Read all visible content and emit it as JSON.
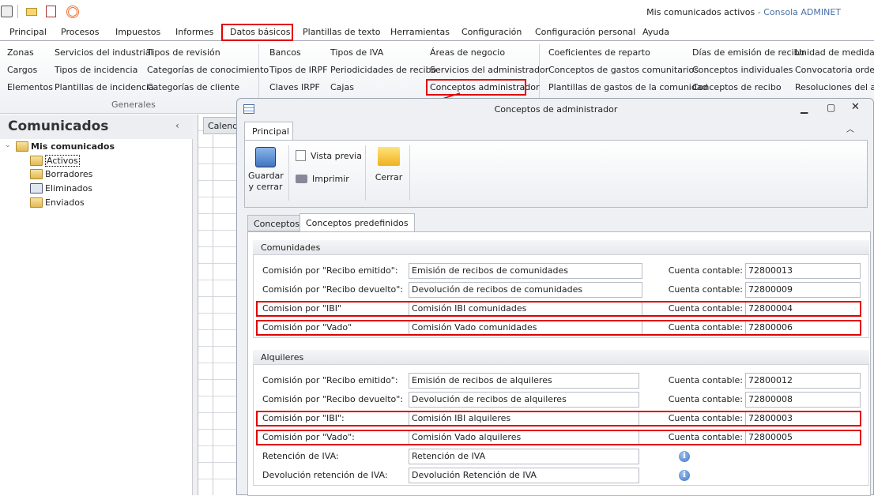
{
  "window": {
    "title_main": "Mis comunicados activos",
    "title_sep": " - ",
    "title_app": "Consola ADMINET"
  },
  "menu": [
    "Principal",
    "Procesos",
    "Impuestos",
    "Informes",
    "Datos básicos",
    "Plantillas de texto",
    "Herramientas",
    "Configuración",
    "Configuración personal",
    "Ayuda"
  ],
  "ribbon": {
    "col1": [
      "Zonas",
      "Cargos",
      "Elementos"
    ],
    "col2": [
      "Servicios del industrial",
      "Tipos de incidencia",
      "Plantillas de incidencia"
    ],
    "col3": [
      "Tipos de revisión",
      "Categorías de conocimiento",
      "Categorías de cliente"
    ],
    "group1": "Generales",
    "col4": [
      "Bancos",
      "Tipos de IRPF",
      "Claves IRPF"
    ],
    "col5": [
      "Tipos de IVA",
      "Periodicidades de recibo",
      "Cajas"
    ],
    "col6": [
      "Áreas de negocio",
      "Servicios del administrador",
      "Conceptos administrador"
    ],
    "col7": [
      "Coeficientes de reparto",
      "Conceptos de gastos comunitarios",
      "Plantillas de gastos de la comunidad"
    ],
    "col8": [
      "Días de emisión de recibo",
      "Conceptos individuales",
      "Conceptos de recibo"
    ],
    "col9": [
      "Unidad de medida",
      "Convocatoria orden del día",
      "Resoluciones del acta"
    ]
  },
  "left": {
    "title": "Comunicados",
    "root": "Mis comunicados",
    "items": [
      "Activos",
      "Borradores",
      "Eliminados",
      "Enviados"
    ],
    "calendar_tab": "Calendario"
  },
  "dialog": {
    "title": "Conceptos de administrador",
    "ribbon_tab": "Principal",
    "save": "Guardar y cerrar",
    "preview": "Vista previa",
    "print": "Imprimir",
    "close": "Cerrar",
    "tabs": [
      "Conceptos",
      "Conceptos predefinidos"
    ],
    "account_label": "Cuenta contable:",
    "comunidades": {
      "header": "Comunidades",
      "rows": [
        {
          "label": "Comisión por \"Recibo emitido\":",
          "value": "Emisión de recibos de comunidades",
          "account": "72800013"
        },
        {
          "label": "Comisión por \"Recibo devuelto\":",
          "value": "Devolución de recibos de comunidades",
          "account": "72800009"
        },
        {
          "label": "Comision por \"IBI\"",
          "value": "Comisión IBI comunidades",
          "account": "72800004"
        },
        {
          "label": "Comisión por \"Vado\"",
          "value": "Comisión Vado comunidades",
          "account": "72800006"
        }
      ]
    },
    "alquileres": {
      "header": "Alquileres",
      "rows": [
        {
          "label": "Comisión por \"Recibo emitido\":",
          "value": "Emisión de recibos de alquileres",
          "account": "72800012"
        },
        {
          "label": "Comisión por \"Recibo devuelto\":",
          "value": "Devolución de recibos de alquileres",
          "account": "72800008"
        },
        {
          "label": "Comisión por \"IBI\":",
          "value": "Comisión IBI alquileres",
          "account": "72800003"
        },
        {
          "label": "Comisión por \"Vado\":",
          "value": "Comisión Vado alquileres",
          "account": "72800005"
        }
      ],
      "extra": [
        {
          "label": "Retención de IVA:",
          "value": "Retención de IVA"
        },
        {
          "label": "Devolución retención de IVA:",
          "value": "Devolución Retención de IVA"
        }
      ]
    }
  }
}
